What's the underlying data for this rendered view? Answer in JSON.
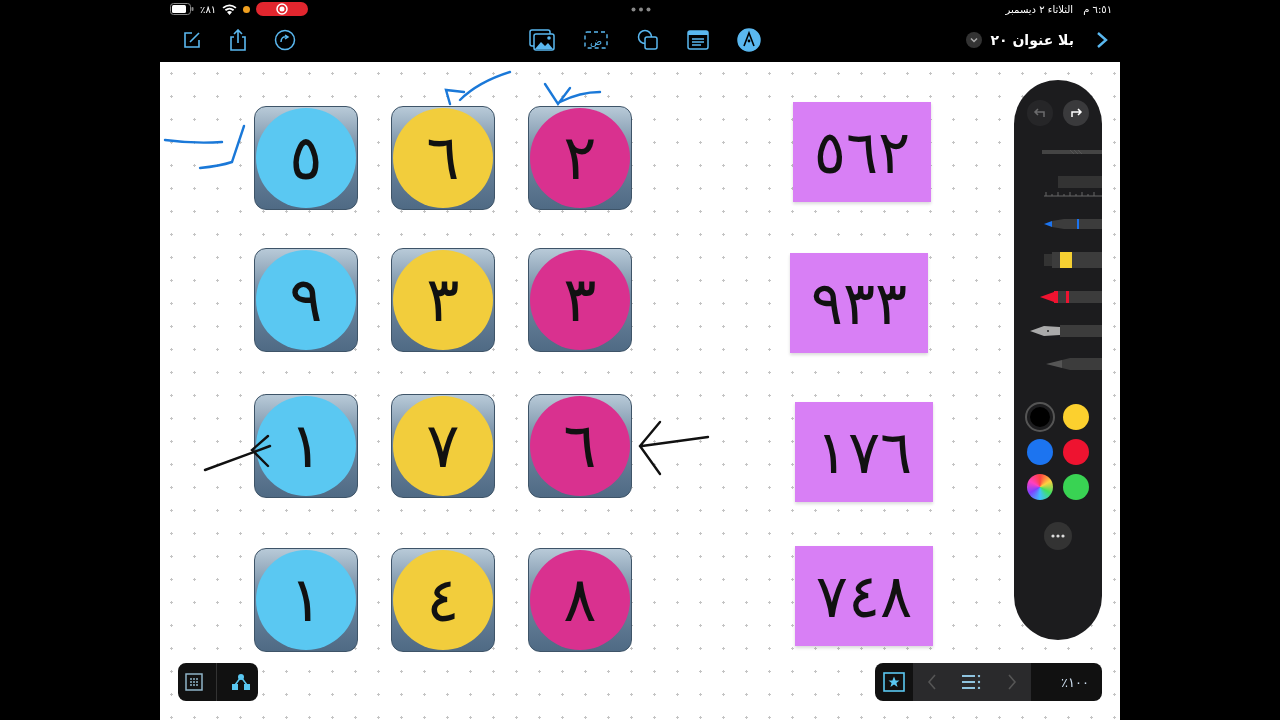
{
  "status_bar": {
    "battery": "٪٨١",
    "time": "٦:٥١ م",
    "date": "الثلاثاء ٢ ديسمبر",
    "recording": true
  },
  "toolbar": {
    "title": "بلا عنوان ٢٠",
    "insert_tools": [
      {
        "kind": "media",
        "selected": false
      },
      {
        "kind": "text",
        "glyph": "ض",
        "selected": false
      },
      {
        "kind": "shapes",
        "selected": false
      },
      {
        "kind": "sticky",
        "selected": false
      },
      {
        "kind": "pen",
        "selected": true
      }
    ]
  },
  "tiles": [
    {
      "digit": "٢",
      "color": "#d9318f"
    },
    {
      "digit": "٦",
      "color": "#f2cd3c"
    },
    {
      "digit": "٥",
      "color": "#5ac8f2"
    },
    {
      "digit": "٣",
      "color": "#d9318f"
    },
    {
      "digit": "٣",
      "color": "#f2cd3c"
    },
    {
      "digit": "٩",
      "color": "#5ac8f2"
    },
    {
      "digit": "٦",
      "color": "#d9318f"
    },
    {
      "digit": "٧",
      "color": "#f2cd3c"
    },
    {
      "digit": "١",
      "color": "#5ac8f2"
    },
    {
      "digit": "٨",
      "color": "#d9318f"
    },
    {
      "digit": "٤",
      "color": "#f2cd3c"
    },
    {
      "digit": "١",
      "color": "#5ac8f2"
    }
  ],
  "sticky_notes": [
    {
      "text": "٥٦٢"
    },
    {
      "text": "٩٣٣"
    },
    {
      "text": "١٧٦"
    },
    {
      "text": "٧٤٨"
    }
  ],
  "palette": {
    "undo": {
      "disabled": true
    },
    "redo": {
      "disabled": false
    },
    "colors": [
      {
        "kind": "swatch",
        "color": "#000000",
        "selected": true
      },
      {
        "kind": "swatch",
        "color": "#fcd02e",
        "selected": false
      },
      {
        "kind": "swatch",
        "color": "#1c74f0",
        "selected": false
      },
      {
        "kind": "swatch",
        "color": "#ee1330",
        "selected": false
      },
      {
        "kind": "wheel",
        "selected": false
      },
      {
        "kind": "swatch",
        "color": "#39d353",
        "selected": false
      }
    ]
  },
  "zoom": "٪١٠٠"
}
